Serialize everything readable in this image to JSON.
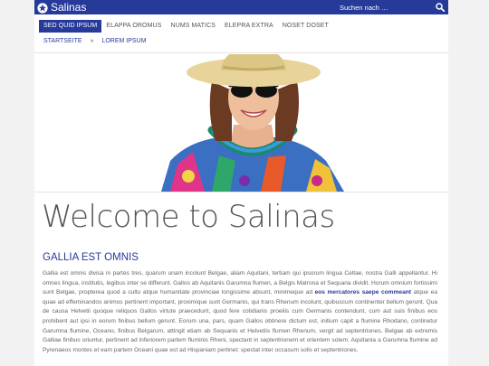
{
  "header": {
    "brand": "Salinas",
    "logo_icon": "star-badge-icon",
    "search_placeholder": "Suchen nach …",
    "search_icon": "search-icon"
  },
  "nav": {
    "items": [
      {
        "label": "SED QUID IPSUM",
        "active": true
      },
      {
        "label": "ELAPPA OROMUS",
        "active": false
      },
      {
        "label": "NUMS MATICS",
        "active": false
      },
      {
        "label": "ELEPRA EXTRA",
        "active": false
      },
      {
        "label": "NOSET DOSET",
        "active": false
      }
    ]
  },
  "breadcrumb": {
    "home": "STARTSEITE",
    "separator": "»",
    "current": "LOREM IPSUM"
  },
  "hero": {
    "image_subject": "woman-in-sun-hat-and-lei"
  },
  "main": {
    "title": "Welcome to Salinas",
    "subtitle": "GALLIA EST OMNIS",
    "paragraph_part1": "Gallia est omnis divisa in partes tres, quarum unam incolunt Belgae, aliam Aquitani, tertiam qui ipsorum lingua Celtae, nostra Galli appellantur. Hi omnes lingua, institutis, legibus inter se differunt. Gallos ab Aquitanis Garumna flumen, a Belgis Matrona et Sequana dividit. Horum omnium fortissimi sunt Belgae, propterea quod a cultu atque humanitate provinciae longissime absunt, minimeque ad ",
    "paragraph_link": "eos mercatores saepe commeant",
    "paragraph_part2": " atque ea quae ad effeminandos animos pertinent important, proximique sunt Germanis, qui trans Rhenum incolunt, quibuscum continenter bellum gerunt. Qua de causa Helvetii quoque reliquos Gallos virtute praecedunt, quod fere cotidianis proeliis cum Germanis contendunt, cum aut suis finibus eos prohibent aut ipsi in eorum finibus bellum gerunt. Eorum una, pars, quam Gallos obtinere dictum est, initium capit a flumine Rhodano, continetur Garumna flumine, Oceano, finibus Belgarum, attingit etiam ab Sequanis et Helvetiis flumen Rhenum, vergit ad septentriones. Belgae ab extremis Galliae finibus oriuntur, pertinent ad inferiorem partem fluminis Rheni, spectant in septentrionem et orientem solem. Aquitania a Garumna flumine ad Pyrenaeos montes et eam partem Oceani quae est ad Hispaniam pertinet; spectat inter occasum solis et septentriones."
  },
  "colors": {
    "accent": "#263a9a",
    "text": "#666666"
  }
}
